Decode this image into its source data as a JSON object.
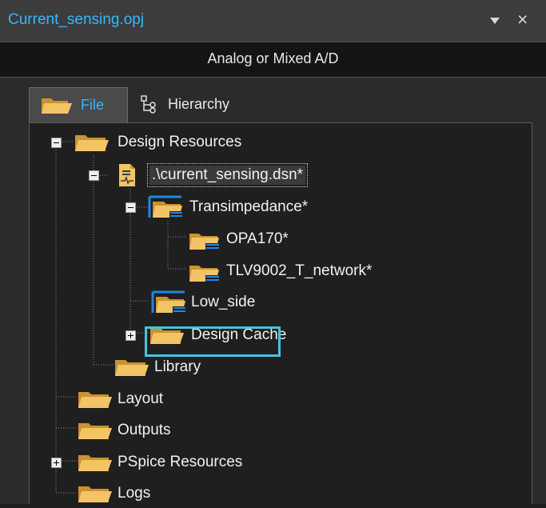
{
  "titlebar": {
    "title": "Current_sensing.opj"
  },
  "project_type": "Analog or Mixed A/D",
  "tabs": [
    {
      "label": "File",
      "active": true
    },
    {
      "label": "Hierarchy",
      "active": false
    }
  ],
  "tree": {
    "design_resources": "Design Resources",
    "dsn_file": ".\\current_sensing.dsn*",
    "transimpedance": "Transimpedance*",
    "opa170": "OPA170*",
    "tlv9002": "TLV9002_T_network*",
    "low_side": "Low_side",
    "design_cache": "Design Cache",
    "library": "Library",
    "layout": "Layout",
    "outputs": "Outputs",
    "pspice_resources": "PSpice Resources",
    "logs": "Logs"
  },
  "colors": {
    "title_accent": "#33b8ff",
    "selection_border": "#45c3e0",
    "folder": "#f0c060",
    "schematic_blue": "#1e88e5"
  }
}
